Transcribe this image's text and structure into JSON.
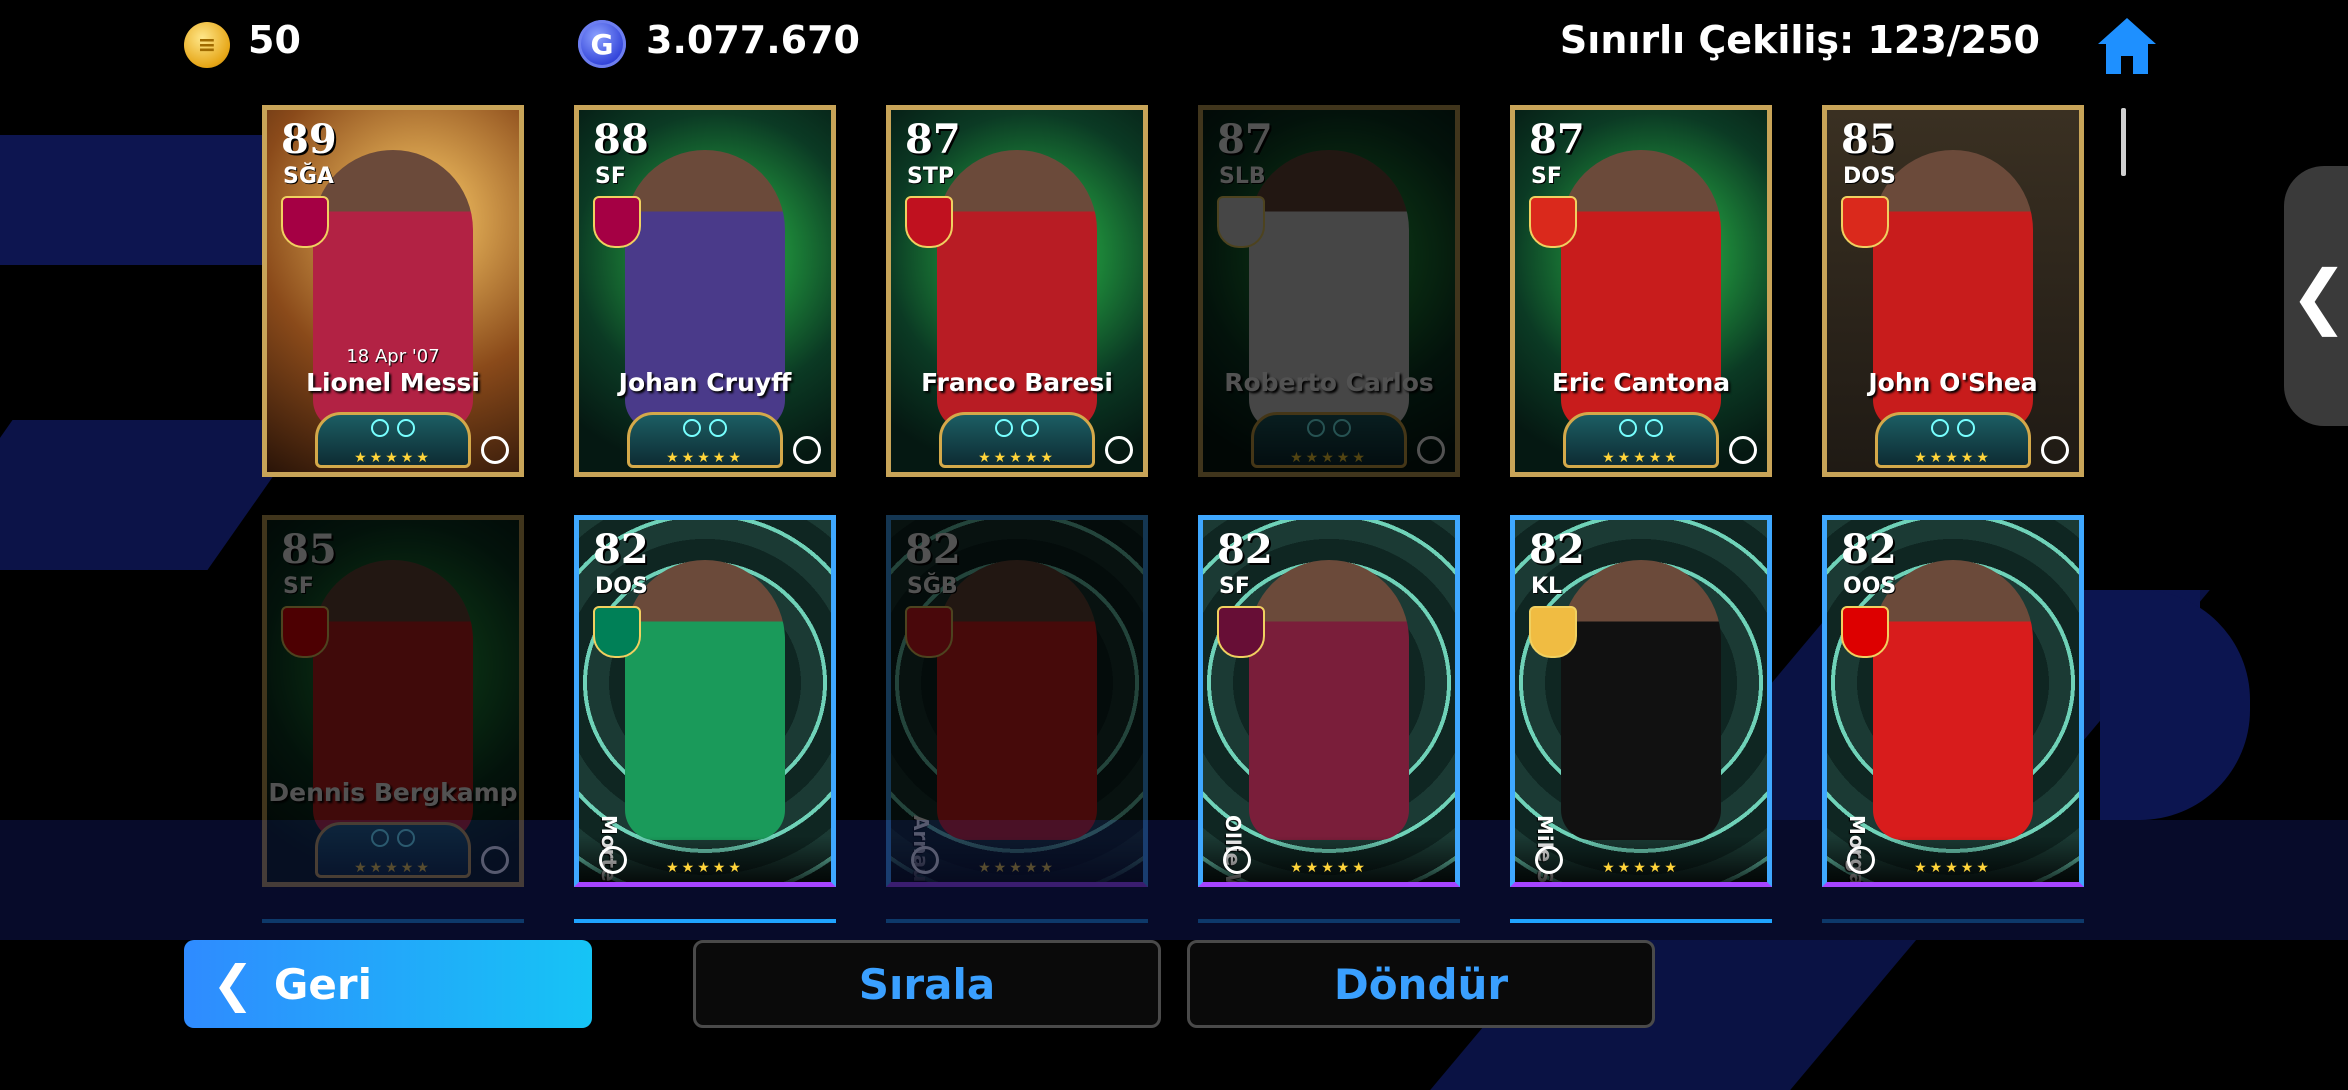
{
  "header": {
    "coins": "50",
    "gp": "3.077.670",
    "gp_icon_letter": "G",
    "limit_label": "Sınırlı Çekiliş: 123/250"
  },
  "cards": [
    {
      "rating": "89",
      "position": "SĞA",
      "name": "Lionel Messi",
      "date": "18 Apr '07",
      "style": "gold",
      "bg": "gold-bg",
      "dim": false,
      "vertical": false,
      "club_color": "#a50044"
    },
    {
      "rating": "88",
      "position": "SF",
      "name": "Johan Cruyff",
      "date": "",
      "style": "gold",
      "bg": "green-bg",
      "dim": false,
      "vertical": false,
      "club_color": "#a50044"
    },
    {
      "rating": "87",
      "position": "STP",
      "name": "Franco Baresi",
      "date": "",
      "style": "gold",
      "bg": "green-bg",
      "dim": false,
      "vertical": false,
      "club_color": "#c0111f"
    },
    {
      "rating": "87",
      "position": "SLB",
      "name": "Roberto Carlos",
      "date": "",
      "style": "gold",
      "bg": "green-bg",
      "dim": true,
      "vertical": false,
      "club_color": "#d8d8d8"
    },
    {
      "rating": "87",
      "position": "SF",
      "name": "Eric Cantona",
      "date": "",
      "style": "gold",
      "bg": "green-bg",
      "dim": false,
      "vertical": false,
      "club_color": "#da291c"
    },
    {
      "rating": "85",
      "position": "DOS",
      "name": "John O'Shea",
      "date": "",
      "style": "gold",
      "bg": "frame-bg",
      "dim": false,
      "vertical": false,
      "club_color": "#da291c"
    },
    {
      "rating": "85",
      "position": "SF",
      "name": "Dennis Bergkamp",
      "date": "",
      "style": "gold",
      "bg": "green-bg",
      "dim": true,
      "vertical": false,
      "club_color": "#ef0107"
    },
    {
      "rating": "82",
      "position": "DOS",
      "name": "Morten Hjulmand",
      "date": "",
      "style": "blue",
      "bg": "tunnel-bg",
      "dim": false,
      "vertical": true,
      "club_color": "#008057"
    },
    {
      "rating": "82",
      "position": "SĞB",
      "name": "Arnau Martínez",
      "date": "",
      "style": "blue",
      "bg": "tunnel-bg",
      "dim": true,
      "vertical": true,
      "club_color": "#e21b22"
    },
    {
      "rating": "82",
      "position": "SF",
      "name": "Ollie Watkins",
      "date": "",
      "style": "blue",
      "bg": "tunnel-bg",
      "dim": false,
      "vertical": true,
      "club_color": "#670e36"
    },
    {
      "rating": "82",
      "position": "KL",
      "name": "Mile Svilar",
      "date": "",
      "style": "blue",
      "bg": "tunnel-bg",
      "dim": false,
      "vertical": true,
      "club_color": "#f0bc42"
    },
    {
      "rating": "82",
      "position": "OOS",
      "name": "Morgan Gibbs-White",
      "date": "",
      "style": "blue",
      "bg": "tunnel-bg",
      "dim": false,
      "vertical": true,
      "club_color": "#dd0000"
    }
  ],
  "buttons": {
    "back": "Geri",
    "sort": "Sırala",
    "rotate": "Döndür"
  },
  "colors": {
    "accent_blue": "#3aa0ff",
    "gold_border": "#c8a458",
    "home_icon": "#1e90ff"
  }
}
